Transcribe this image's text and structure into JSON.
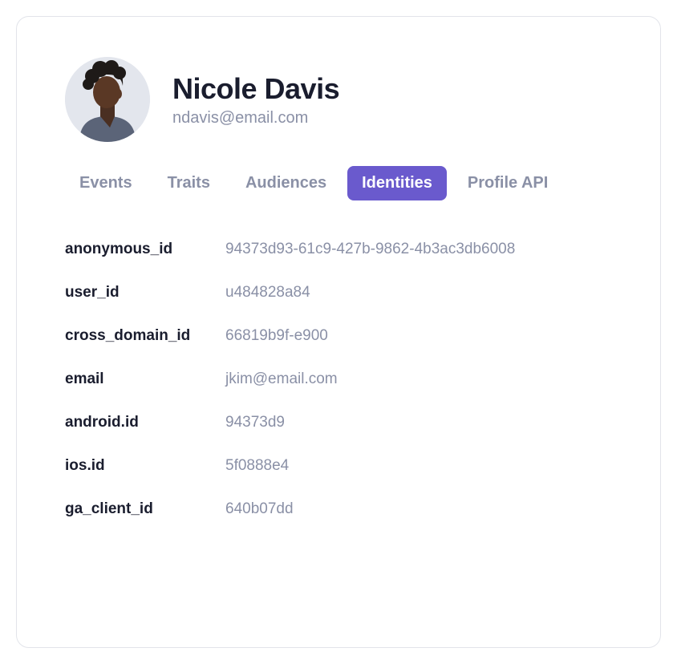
{
  "profile": {
    "name": "Nicole Davis",
    "email": "ndavis@email.com"
  },
  "tabs": [
    {
      "label": "Events",
      "active": false
    },
    {
      "label": "Traits",
      "active": false
    },
    {
      "label": "Audiences",
      "active": false
    },
    {
      "label": "Identities",
      "active": true
    },
    {
      "label": "Profile API",
      "active": false
    }
  ],
  "identities": [
    {
      "key": "anonymous_id",
      "value": "94373d93-61c9-427b-9862-4b3ac3db6008"
    },
    {
      "key": "user_id",
      "value": "u484828a84"
    },
    {
      "key": "cross_domain_id",
      "value": "66819b9f-e900"
    },
    {
      "key": "email",
      "value": "jkim@email.com"
    },
    {
      "key": "android.id",
      "value": "94373d9"
    },
    {
      "key": "ios.id",
      "value": "5f0888e4"
    },
    {
      "key": "ga_client_id",
      "value": "640b07dd"
    }
  ],
  "colors": {
    "accent": "#6a5acd",
    "textPrimary": "#1a1d2e",
    "textSecondary": "#8a90a6",
    "border": "#e2e4ea",
    "avatarBg": "#e3e6ed"
  }
}
